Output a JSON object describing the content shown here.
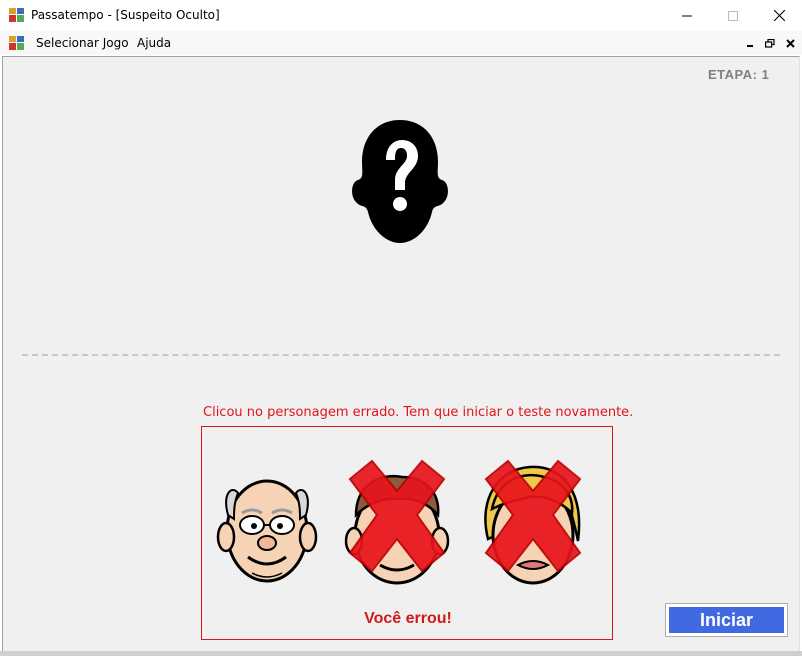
{
  "window": {
    "title": "Passatempo - [Suspeito Oculto]",
    "icon": "app-icon"
  },
  "menu": {
    "items": [
      {
        "label": "Selecionar Jogo"
      },
      {
        "label": "Ajuda"
      }
    ]
  },
  "game": {
    "stage_label": "ETAPA: 1",
    "mystery_icon": "mystery-head-icon",
    "message": "Clicou no personagem errado. Tem que iniciar o teste novamente.",
    "result": "Você errou!",
    "characters": [
      {
        "name": "old-man-face",
        "crossed": false
      },
      {
        "name": "young-man-face",
        "crossed": true
      },
      {
        "name": "woman-face",
        "crossed": true
      }
    ],
    "start_button": "Iniciar"
  },
  "colors": {
    "error": "#e0141b",
    "button": "#4169e1",
    "stage_text": "#808080"
  }
}
